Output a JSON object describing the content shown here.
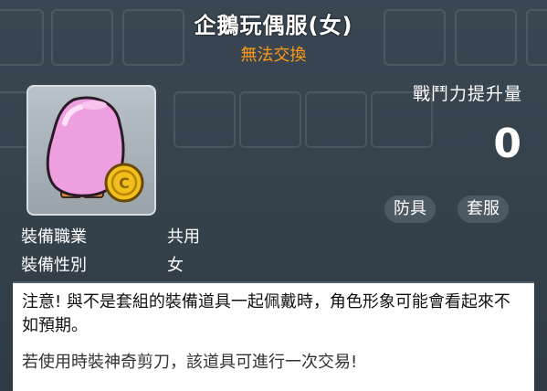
{
  "item": {
    "name": "企鵝玩偶服(女)",
    "trade_status": "無法交換",
    "icon": "pink-egg-penguin-costume-icon"
  },
  "power": {
    "label": "戰鬥力提升量",
    "value": "0"
  },
  "categories": [
    "防具",
    "套服"
  ],
  "stats": [
    {
      "key": "裝備職業",
      "value": "共用"
    },
    {
      "key": "裝備性別",
      "value": "女"
    }
  ],
  "notice": {
    "warning": "注意! 與不是套組的裝備道具一起佩戴時，角色形象可能會看起來不如預期。",
    "scissors": "若使用時裝神奇剪刀，該道具可進行一次交易!"
  },
  "colors": {
    "panel_bg": "#34404a",
    "trade_status": "#ff9a1a",
    "chip_bg": "#4d5963",
    "egg_pink": "#ee9fe0",
    "coin_gold": "#f2c01c"
  }
}
